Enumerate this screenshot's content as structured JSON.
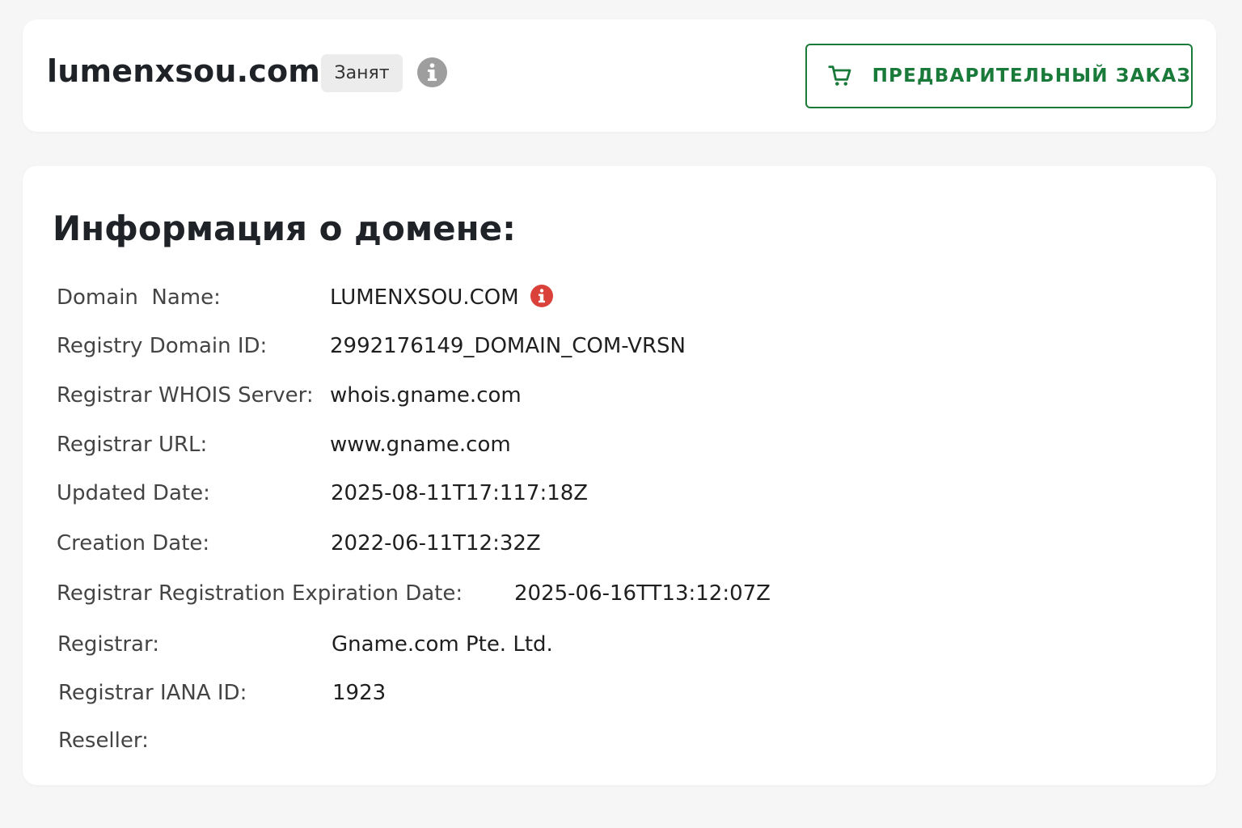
{
  "header": {
    "domain": "lumenxsou.com",
    "status": "Занят",
    "info_icon": "info-icon",
    "preorder_label": "ПРЕДВАРИТЕЛЬНЫЙ ЗАКАЗ",
    "preorder_icon": "cart-icon"
  },
  "info": {
    "title": "Информация о домене:",
    "rows": [
      {
        "label": "Domain  Name:",
        "value": "LUMENXSOU.COM"
      },
      {
        "label": "Registry Domain ID:",
        "value": "2992176149_DOMAIN_COM-VRSN"
      },
      {
        "label": "Registrar WHOIS Server:",
        "value": "whois.gname.com"
      },
      {
        "label": "Registrar URL:",
        "value": "www.gname.com"
      },
      {
        "label": "Updated Date:",
        "value": "2025-08-11T17:117:18Z"
      },
      {
        "label": "Creation Date:",
        "value": "2022-06-11T12:32Z"
      },
      {
        "label": "Registrar Registration Expiration Date:",
        "value": "2025-06-16TT13:12:07Z"
      },
      {
        "label": "Registrar:",
        "value": "Gname.com Pte. Ltd."
      },
      {
        "label": "Registrar IANA ID:",
        "value": "1923"
      },
      {
        "label": "Reseller:",
        "value": ""
      }
    ]
  },
  "colors": {
    "accent_green": "#1a7a3a",
    "alert_red": "#d9413a",
    "icon_gray": "#9e9e9e",
    "badge_bg": "#ececec"
  }
}
